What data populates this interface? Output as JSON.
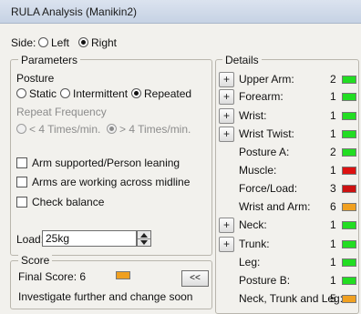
{
  "window": {
    "title": "RULA Analysis (Manikin2)"
  },
  "side": {
    "label": "Side:",
    "options": [
      "Left",
      "Right"
    ],
    "selected": "Right"
  },
  "parameters": {
    "legend": "Parameters",
    "posture": {
      "label": "Posture",
      "options": [
        "Static",
        "Intermittent",
        "Repeated"
      ],
      "selected": "Repeated"
    },
    "repeat_frequency": {
      "label": "Repeat Frequency",
      "options": [
        "< 4 Times/min.",
        "> 4 Times/min."
      ],
      "selected": "> 4 Times/min."
    },
    "checks": [
      {
        "label": "Arm supported/Person leaning",
        "checked": false
      },
      {
        "label": "Arms are working across midline",
        "checked": false
      },
      {
        "label": "Check balance",
        "checked": false
      }
    ],
    "load": {
      "label": "Load:",
      "value": "25kg"
    }
  },
  "score": {
    "legend": "Score",
    "final": "Final Score: 6",
    "message": "Investigate further and change soon",
    "back_button": "<<",
    "final_color": "#f0a020"
  },
  "details": {
    "legend": "Details",
    "plus_label": "+",
    "rows": [
      {
        "label": "Upper Arm:",
        "value": "2",
        "color": "#22dd22",
        "expand": true
      },
      {
        "label": "Forearm:",
        "value": "1",
        "color": "#22dd22",
        "expand": true
      },
      {
        "label": "Wrist:",
        "value": "1",
        "color": "#22dd22",
        "expand": true
      },
      {
        "label": "Wrist Twist:",
        "value": "1",
        "color": "#22dd22",
        "expand": true
      },
      {
        "label": "Posture A:",
        "value": "2",
        "color": "#22dd22",
        "expand": false
      },
      {
        "label": "Muscle:",
        "value": "1",
        "color": "#dd1111",
        "expand": false
      },
      {
        "label": "Force/Load:",
        "value": "3",
        "color": "#cc1111",
        "expand": false
      },
      {
        "label": "Wrist and Arm:",
        "value": "6",
        "color": "#f0a020",
        "expand": false
      },
      {
        "label": "Neck:",
        "value": "1",
        "color": "#22dd22",
        "expand": true
      },
      {
        "label": "Trunk:",
        "value": "1",
        "color": "#22dd22",
        "expand": true
      },
      {
        "label": "Leg:",
        "value": "1",
        "color": "#22dd22",
        "expand": false
      },
      {
        "label": "Posture B:",
        "value": "1",
        "color": "#22dd22",
        "expand": false
      },
      {
        "label": "Neck, Trunk and Leg:",
        "value": "5",
        "color": "#f0a020",
        "expand": false
      }
    ]
  }
}
